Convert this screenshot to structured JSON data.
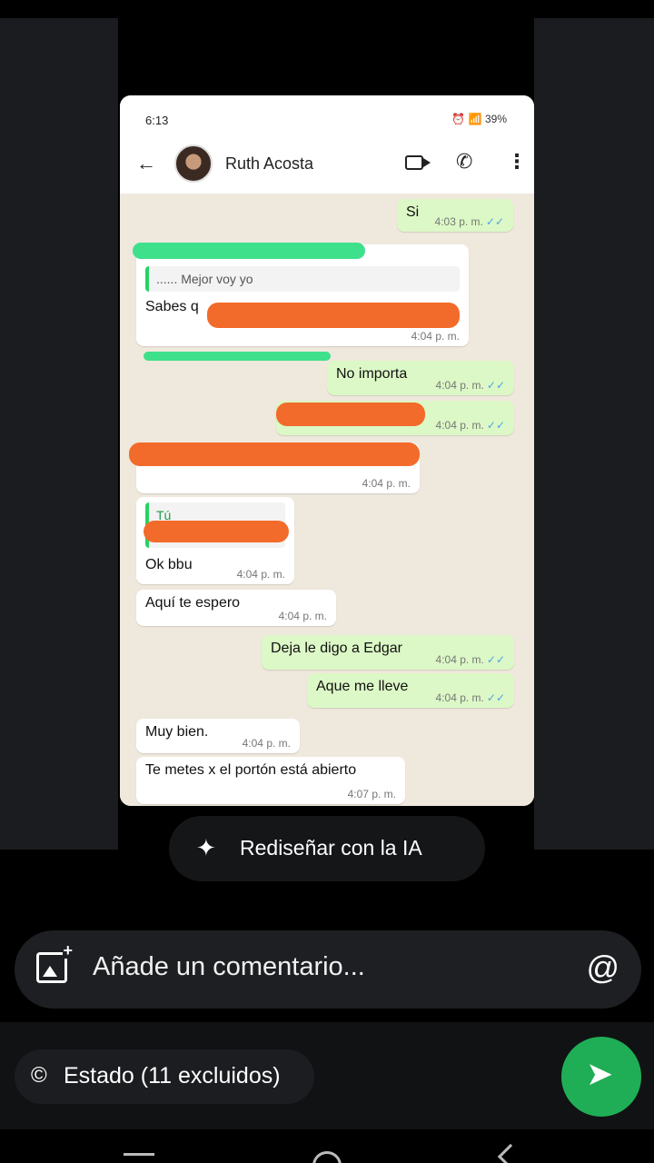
{
  "screenshot": {
    "status_time": "6:13",
    "battery": "39%",
    "contact_name": "Ruth Acosta",
    "messages": [
      {
        "side": "out",
        "text": "Si",
        "time": "4:03 p. m."
      },
      {
        "side": "in",
        "quote": "...... Mejor voy yo",
        "text": "Sabes q",
        "time": "4:04 p. m."
      },
      {
        "side": "out",
        "text": "No importa",
        "time": "4:04 p. m."
      },
      {
        "side": "out",
        "text": "",
        "time": "4:04 p. m."
      },
      {
        "side": "in",
        "text": "",
        "time": "4:04 p. m."
      },
      {
        "side": "in",
        "quote_author": "Tú",
        "text": "Ok bbu",
        "time": "4:04 p. m."
      },
      {
        "side": "in",
        "text": "Aquí te espero",
        "time": "4:04 p. m."
      },
      {
        "side": "out",
        "text": "Deja le digo a Edgar",
        "time": "4:04 p. m."
      },
      {
        "side": "out",
        "text": "Aque me lleve",
        "time": "4:04 p. m."
      },
      {
        "side": "in",
        "text": "Muy bien.",
        "time": "4:04 p. m."
      },
      {
        "side": "in",
        "text": "Te metes x el portón está abierto",
        "time": "4:07 p. m."
      }
    ]
  },
  "ai_button": {
    "label": "Rediseñar con la IA"
  },
  "comment": {
    "placeholder": "Añade un comentario..."
  },
  "status_pill": {
    "label": "Estado (11 excluidos)"
  },
  "colors": {
    "send": "#1fae56",
    "outgoing": "#dcf8c6",
    "redaction_orange": "#f26b2a",
    "redaction_green": "#3fe08c"
  }
}
